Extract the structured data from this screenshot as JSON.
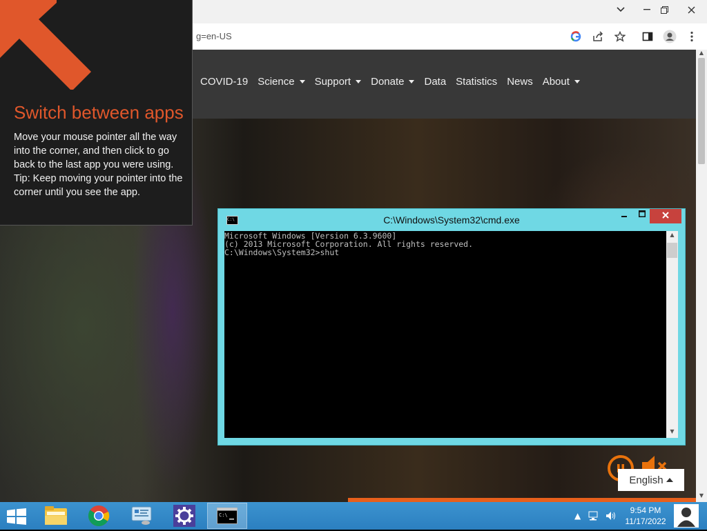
{
  "browser": {
    "url_fragment": "g=en-US",
    "window_controls": {
      "dropdown": "chevron-down",
      "minimize": "minimize",
      "restore": "restore",
      "close": "close"
    },
    "toolbar_icons": [
      "google-icon",
      "share-icon",
      "star-icon",
      "side-panel-icon",
      "profile-icon",
      "menu-icon"
    ]
  },
  "site": {
    "nav": [
      {
        "label": "COVID-19",
        "dropdown": false
      },
      {
        "label": "Science",
        "dropdown": true
      },
      {
        "label": "Support",
        "dropdown": true
      },
      {
        "label": "Donate",
        "dropdown": true
      },
      {
        "label": "Data",
        "dropdown": false
      },
      {
        "label": "Statistics",
        "dropdown": false
      },
      {
        "label": "News",
        "dropdown": false
      },
      {
        "label": "About",
        "dropdown": true
      }
    ],
    "language_button": "English",
    "accent_color": "#e8720c"
  },
  "tip": {
    "title": "Switch between apps",
    "body_line1": "Move your mouse pointer all the way into the corner, and then click to go back to the last app you were using.",
    "body_line2": "Tip: Keep moving your pointer into the corner until you see the app.",
    "accent_color": "#e0572b"
  },
  "cmd": {
    "title": "C:\\Windows\\System32\\cmd.exe",
    "icon_text": "C:\\",
    "output": "Microsoft Windows [Version 6.3.9600]\n(c) 2013 Microsoft Corporation. All rights reserved.\nC:\\Windows\\System32>shut"
  },
  "taskbar": {
    "apps": [
      {
        "name": "file-explorer",
        "active": false
      },
      {
        "name": "chrome",
        "active": false
      },
      {
        "name": "control-panel",
        "active": false
      },
      {
        "name": "settings",
        "active": false
      },
      {
        "name": "command-prompt",
        "active": true
      }
    ],
    "clock_time": "9:54 PM",
    "clock_date": "11/17/2022",
    "tray_icons": [
      "show-hidden-icons-icon",
      "network-icon",
      "volume-icon"
    ]
  }
}
